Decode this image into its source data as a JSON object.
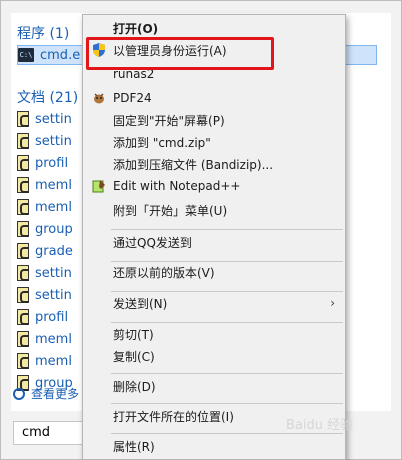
{
  "results": {
    "programs_title": "程序 (1)",
    "program_item": "cmd.e",
    "documents_title": "文档 (21)",
    "doc_items": [
      "settin",
      "settin",
      "profil",
      "meml",
      "meml",
      "group",
      "grade",
      "settin",
      "settin",
      "profil",
      "meml",
      "meml",
      "group"
    ],
    "see_more": "查看更多",
    "search_value": "cmd"
  },
  "context_menu": {
    "items": [
      {
        "label": "打开(O)"
      },
      {
        "label": "以管理员身份运行(A)"
      },
      {
        "label": "runas2"
      },
      {
        "label": "PDF24"
      },
      {
        "label": "固定到\"开始\"屏幕(P)"
      },
      {
        "label": "添加到 \"cmd.zip\""
      },
      {
        "label": "添加到压缩文件 (Bandizip)..."
      },
      {
        "label": "Edit with Notepad++"
      },
      {
        "label": "附到「开始」菜单(U)"
      },
      {
        "label": "通过QQ发送到"
      },
      {
        "label": "还原以前的版本(V)"
      },
      {
        "label": "发送到(N)"
      },
      {
        "label": "剪切(T)"
      },
      {
        "label": "复制(C)"
      },
      {
        "label": "删除(D)"
      },
      {
        "label": "打开文件所在的位置(I)"
      },
      {
        "label": "属性(R)"
      }
    ],
    "submenu_arrow": "›"
  },
  "watermark": "Baidu 经验",
  "colors": {
    "highlight": "#e0161b",
    "link": "#1a5fb4"
  }
}
